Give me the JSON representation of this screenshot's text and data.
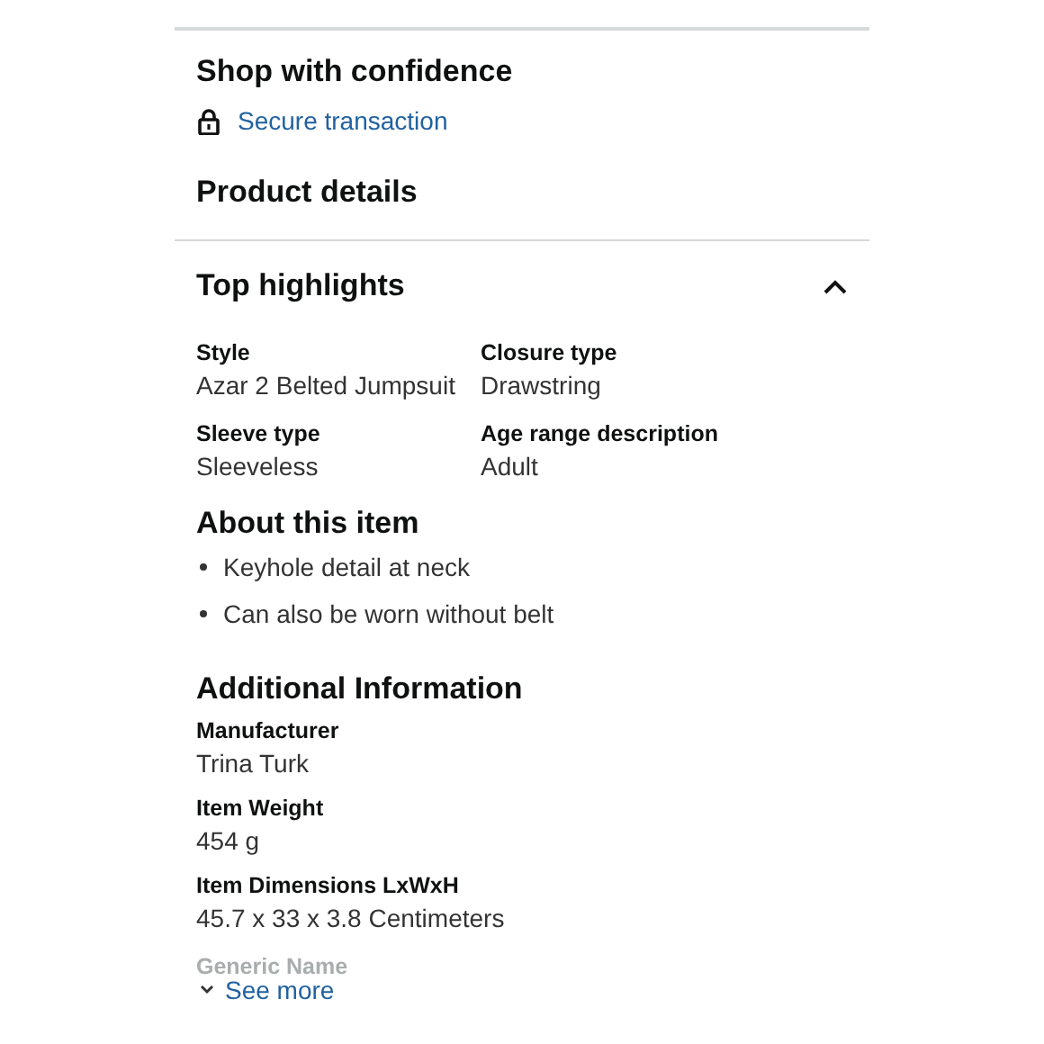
{
  "shop": {
    "title": "Shop with confidence",
    "link": "Secure transaction"
  },
  "product_details": {
    "title": "Product details"
  },
  "top_highlights": {
    "title": "Top highlights",
    "expanded": true,
    "attributes": [
      {
        "label": "Style",
        "value": "Azar 2 Belted Jumpsuit"
      },
      {
        "label": "Closure type",
        "value": "Drawstring"
      },
      {
        "label": "Sleeve type",
        "value": "Sleeveless"
      },
      {
        "label": "Age range description",
        "value": "Adult"
      }
    ]
  },
  "about": {
    "title": "About this item",
    "bullets": [
      "Keyhole detail at neck",
      "Can also be worn without belt"
    ]
  },
  "additional": {
    "title": "Additional Information",
    "items": [
      {
        "label": "Manufacturer",
        "value": "Trina Turk"
      },
      {
        "label": "Item Weight",
        "value": "454 g"
      },
      {
        "label": "Item Dimensions LxWxH",
        "value": "45.7 x 33 x 3.8 Centimeters"
      }
    ],
    "faded_label": "Generic Name"
  },
  "see_more": "See more"
}
